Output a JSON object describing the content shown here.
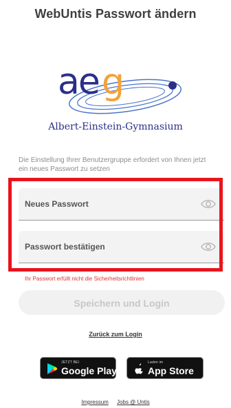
{
  "header": {
    "title": "WebUntis Passwort ändern"
  },
  "logo": {
    "text": "aeg",
    "school_name": "Albert-Einstein-Gymnasium",
    "colors": {
      "letters": "#2b2f8a",
      "g": "#f2a23a",
      "orbit": "#4a74c9",
      "dot": "#2b2f8a"
    }
  },
  "info_text": "Die Einstellung Ihrer Benutzergruppe erfordert von Ihnen jetzt ein neues Passwort zu setzen",
  "form": {
    "new_password": {
      "label": "Neues Passwort",
      "value": "",
      "icon": "eye-icon"
    },
    "confirm_password": {
      "label": "Passwort bestätigen",
      "value": "",
      "icon": "eye-icon"
    },
    "error_text": "Ihr Passwort erfüllt nicht die Sicherheitsrichtlinien",
    "submit_label": "Speichern und Login",
    "back_link": "Zurück zum Login"
  },
  "stores": {
    "google_play": {
      "small": "JETZT BEI",
      "big": "Google Play",
      "icon": "google-play-icon"
    },
    "app_store": {
      "small": "Laden im",
      "big": "App Store",
      "icon": "apple-icon"
    }
  },
  "footer": {
    "impressum": "Impressum",
    "jobs": "Jobs @ Untis"
  },
  "colors": {
    "highlight": "#e8141c",
    "error": "#e03030",
    "button_bg": "#f1f1f1",
    "button_text": "#c7c7c7"
  }
}
